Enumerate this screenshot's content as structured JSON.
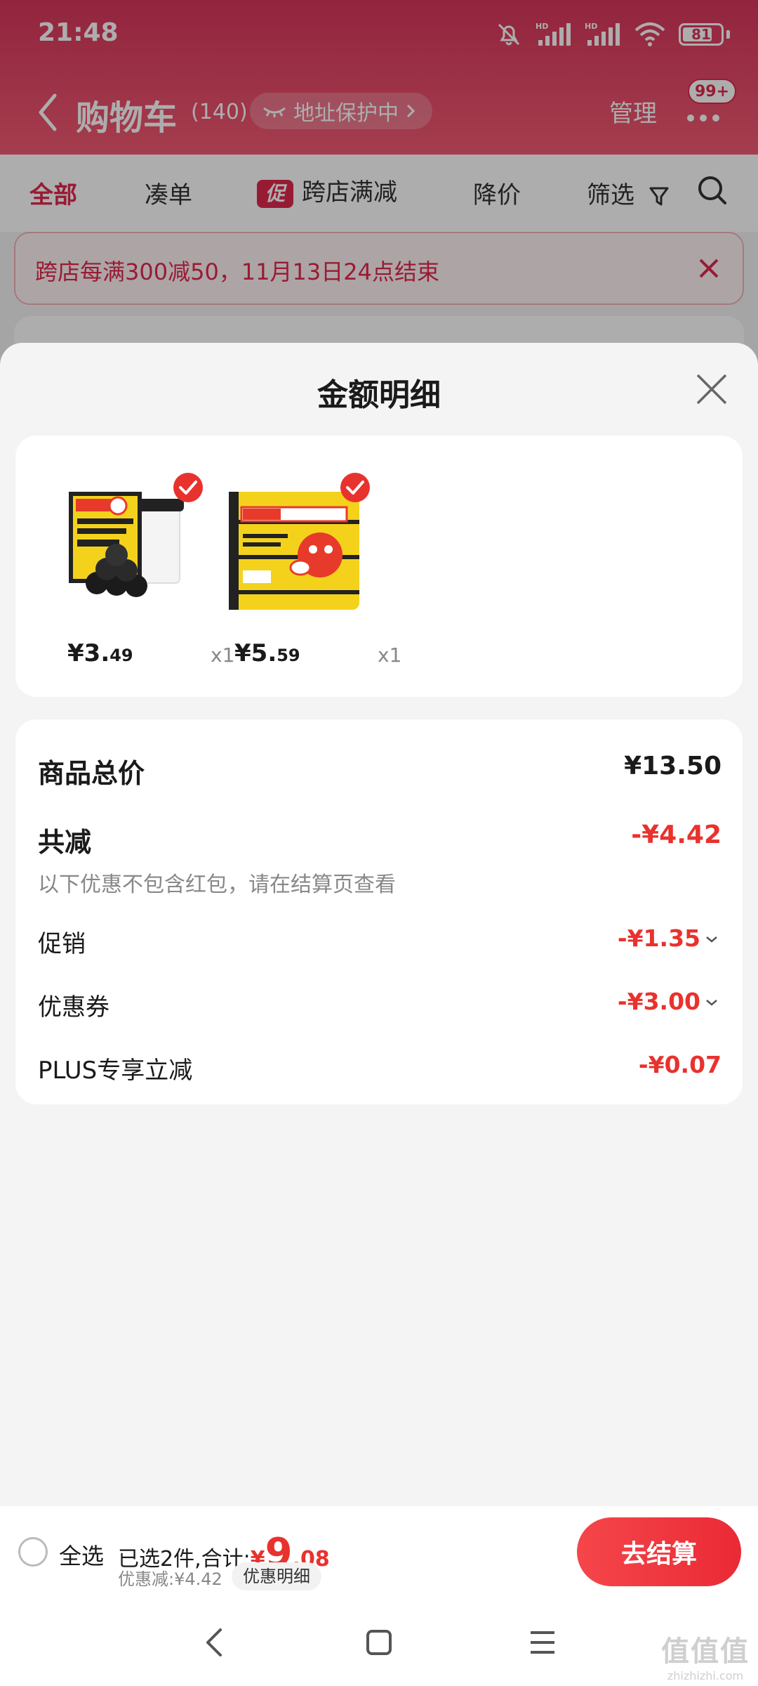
{
  "status_bar": {
    "time": "21:48",
    "battery": "81",
    "battery_level": 0.81
  },
  "header": {
    "title": "购物车",
    "count": "(140)",
    "address_pill": "地址保护中",
    "manage": "管理",
    "more_badge": "99+"
  },
  "tabs": {
    "all": "全部",
    "bundle": "凑单",
    "promo_mark": "促",
    "cross_store": "跨店满减",
    "price_drop": "降价",
    "filter": "筛选"
  },
  "notice": {
    "text": "跨店每满300减50，11月13日24点结束"
  },
  "sheet": {
    "title": "金额明细",
    "goods": [
      {
        "price_int": "¥3.",
        "price_dec": "49",
        "qty": "x1",
        "icon": "trash-bag-product-image"
      },
      {
        "price_int": "¥5.",
        "price_dec": "59",
        "qty": "x1",
        "icon": "trash-bag-product-image"
      }
    ],
    "detail": {
      "total_label": "商品总价",
      "total_value": "¥13.50",
      "reduce_label": "共减",
      "reduce_value": "-¥4.42",
      "reduce_note": "以下优惠不包含红包，请在结算页查看",
      "items": [
        {
          "label": "促销",
          "value": "-¥1.35",
          "chevron": true
        },
        {
          "label": "优惠券",
          "value": "-¥3.00",
          "chevron": true
        },
        {
          "label": "PLUS专享立减",
          "value": "-¥0.07",
          "chevron": false
        }
      ]
    }
  },
  "bottom_bar": {
    "select_all": "全选",
    "selected_text": "已选2件,合计:",
    "currency": "¥",
    "total_int": "9",
    "total_dec": ".08",
    "discount_text": "优惠减:¥4.42",
    "discount_detail": "优惠明细",
    "checkout": "去结算"
  },
  "watermark": {
    "main": "值值值",
    "sub": "zhizhizhi.com"
  },
  "colors": {
    "accent_red": "#e8322e",
    "header_pink": "#d8365c"
  }
}
